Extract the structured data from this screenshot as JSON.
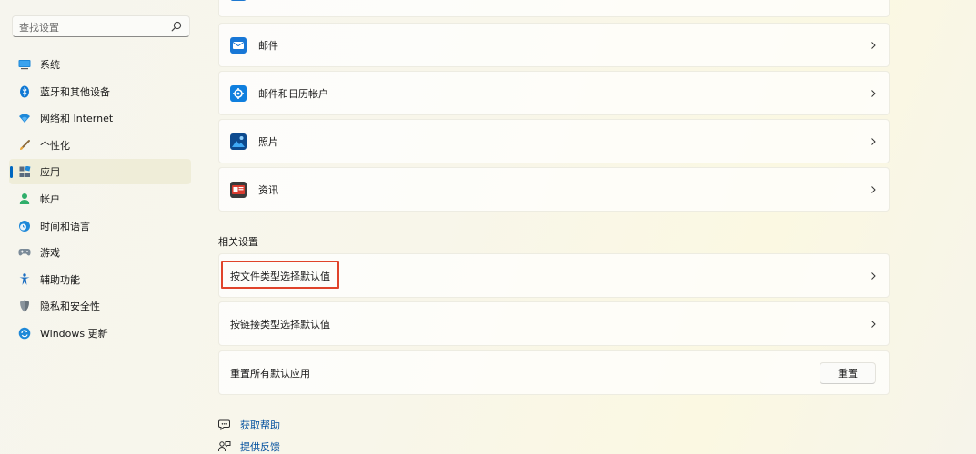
{
  "search": {
    "placeholder": "查找设置"
  },
  "sidebar": {
    "items": [
      {
        "label": "系统",
        "icon": "monitor-icon"
      },
      {
        "label": "蓝牙和其他设备",
        "icon": "bluetooth-icon"
      },
      {
        "label": "网络和 Internet",
        "icon": "wifi-icon"
      },
      {
        "label": "个性化",
        "icon": "brush-icon"
      },
      {
        "label": "应用",
        "icon": "apps-icon",
        "active": true
      },
      {
        "label": "帐户",
        "icon": "person-icon"
      },
      {
        "label": "时间和语言",
        "icon": "globe-clock-icon"
      },
      {
        "label": "游戏",
        "icon": "gamepad-icon"
      },
      {
        "label": "辅助功能",
        "icon": "accessibility-icon"
      },
      {
        "label": "隐私和安全性",
        "icon": "shield-icon"
      },
      {
        "label": "Windows 更新",
        "icon": "update-icon"
      }
    ]
  },
  "apps": [
    {
      "label": "邮件",
      "icon": "mail-icon"
    },
    {
      "label": "邮件和日历帐户",
      "icon": "settings-gear-icon"
    },
    {
      "label": "照片",
      "icon": "photos-icon"
    },
    {
      "label": "资讯",
      "icon": "news-icon"
    }
  ],
  "related": {
    "title": "相关设置",
    "items": [
      {
        "label": "按文件类型选择默认值"
      },
      {
        "label": "按链接类型选择默认值"
      },
      {
        "label": "重置所有默认应用",
        "button": "重置"
      }
    ]
  },
  "footer": {
    "help": "获取帮助",
    "feedback": "提供反馈"
  },
  "colors": {
    "accent": "#0067c0",
    "highlight": "#e0432a",
    "link": "#004f9e"
  }
}
